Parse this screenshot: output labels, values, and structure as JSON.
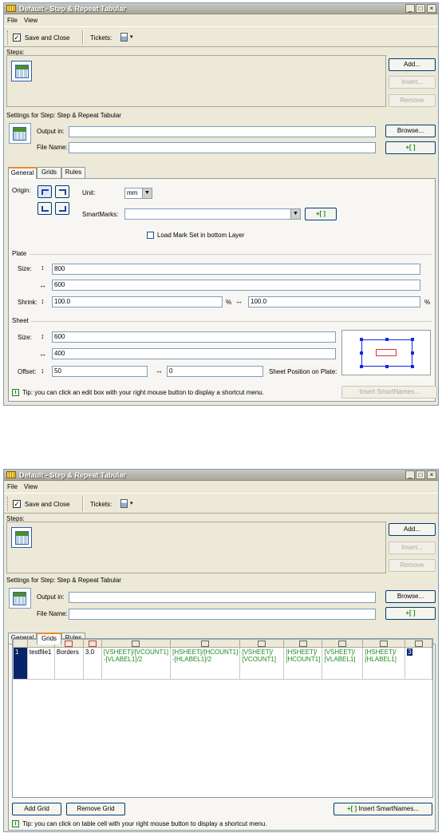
{
  "window1": {
    "title": "Default - Step & Repeat Tabular",
    "menu": [
      "File",
      "View"
    ],
    "toolbar": {
      "save_close": "Save and Close",
      "tickets": "Tickets:"
    },
    "steps_label": "Steps:",
    "step_buttons": {
      "add": "Add...",
      "insert": "Insert...",
      "remove": "Remove"
    },
    "settings_label": "Settings for Step: Step & Repeat Tabular",
    "output_label": "Output in:",
    "filename_label": "File Name:",
    "output_value": "",
    "filename_value": "",
    "browse": "Browse...",
    "smart_btn": "+[ ]",
    "tabs": [
      "General",
      "Grids",
      "Rules"
    ],
    "active_tab": "General",
    "origin_label": "Origin:",
    "unit_label": "Unit:",
    "unit_value": "mm",
    "smartmarks_label": "SmartMarks:",
    "smartmarks_value": "",
    "load_mark_set": "Load Mark Set in bottom Layer",
    "plate": {
      "group": "Plate",
      "size_label": "Size:",
      "width": "800",
      "height": "600",
      "shrink_label": "Shrink:",
      "shrink_x": "100.0",
      "shrink_y": "100.0",
      "pct1": "%",
      "pct2": "%"
    },
    "sheet": {
      "group": "Sheet",
      "size_label": "Size:",
      "width": "600",
      "height": "400",
      "offset_label": "Offset:",
      "offset_x": "50",
      "offset_y": "0",
      "position_label": "Sheet Position on Plate:"
    },
    "tip": "Tip: you can click an edit box with your right mouse button to display a shortcut menu.",
    "insert_smartnames": "Insert SmartNames..."
  },
  "window2": {
    "title": "Default - Step & Repeat Tabular",
    "menu": [
      "File",
      "View"
    ],
    "toolbar": {
      "save_close": "Save and Close",
      "tickets": "Tickets:"
    },
    "steps_label": "Steps:",
    "step_buttons": {
      "add": "Add...",
      "insert": "Insert...",
      "remove": "Remove"
    },
    "settings_label": "Settings for Step: Step & Repeat Tabular",
    "output_label": "Output in:",
    "filename_label": "File Name:",
    "browse": "Browse...",
    "smart_btn": "+[ ]",
    "tabs": [
      "General",
      "Grids",
      "Rules"
    ],
    "active_tab": "Grids",
    "grid_rows": [
      {
        "num": "1",
        "name": "testfile1",
        "marks": "Borders",
        "version": "3.0",
        "y_pos": "[VSHEET]/[VCOUNT1] -[VLABEL1]/2",
        "x_pos": "[HSHEET]/[HCOUNT1] -[HLABEL1]/2",
        "v_step": "[VSHEET]/ [VCOUNT1]",
        "h_step": "[HSHEET]/ [HCOUNT1]",
        "v_label": "[VSHEET]/ [VLABEL1]",
        "h_label": "[HSHEET]/ [HLABEL1]",
        "last": "3"
      }
    ],
    "add_grid": "Add Grid",
    "remove_grid": "Remove Grid",
    "insert_smartnames": "Insert SmartNames...",
    "tip": "Tip: you can click on table cell with your right mouse button to display a shortcut menu."
  }
}
